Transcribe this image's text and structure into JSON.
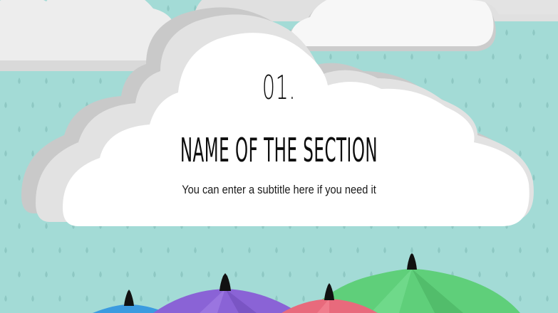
{
  "slide": {
    "section_number": "01.",
    "title": "NAME OF THE SECTION",
    "subtitle": "You can enter a subtitle here if you need it"
  },
  "colors": {
    "background": "#a3dbd6",
    "raindrop": "#8ec8c3",
    "cloud_front": "#ffffff",
    "cloud_shadow": "#d9d9d9",
    "umbrella_blue": "#3b9be0",
    "umbrella_purple": "#8a63d6",
    "umbrella_red": "#e86a7c",
    "umbrella_green": "#5fcf7a",
    "umbrella_tip": "#111111"
  }
}
